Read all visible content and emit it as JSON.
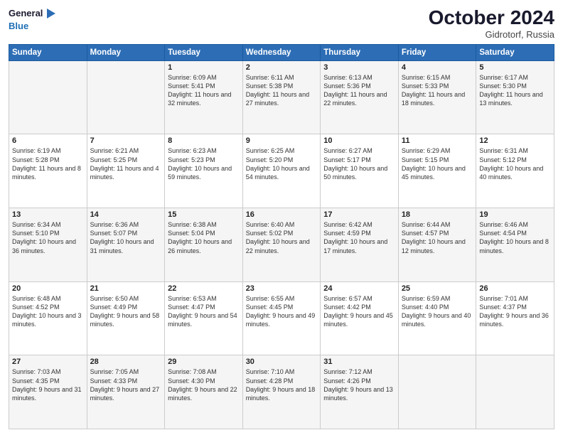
{
  "header": {
    "logo_line1": "General",
    "logo_line2": "Blue",
    "month": "October 2024",
    "location": "Gidrotorf, Russia"
  },
  "days_of_week": [
    "Sunday",
    "Monday",
    "Tuesday",
    "Wednesday",
    "Thursday",
    "Friday",
    "Saturday"
  ],
  "weeks": [
    [
      {
        "day": "",
        "sunrise": "",
        "sunset": "",
        "daylight": ""
      },
      {
        "day": "",
        "sunrise": "",
        "sunset": "",
        "daylight": ""
      },
      {
        "day": "1",
        "sunrise": "Sunrise: 6:09 AM",
        "sunset": "Sunset: 5:41 PM",
        "daylight": "Daylight: 11 hours and 32 minutes."
      },
      {
        "day": "2",
        "sunrise": "Sunrise: 6:11 AM",
        "sunset": "Sunset: 5:38 PM",
        "daylight": "Daylight: 11 hours and 27 minutes."
      },
      {
        "day": "3",
        "sunrise": "Sunrise: 6:13 AM",
        "sunset": "Sunset: 5:36 PM",
        "daylight": "Daylight: 11 hours and 22 minutes."
      },
      {
        "day": "4",
        "sunrise": "Sunrise: 6:15 AM",
        "sunset": "Sunset: 5:33 PM",
        "daylight": "Daylight: 11 hours and 18 minutes."
      },
      {
        "day": "5",
        "sunrise": "Sunrise: 6:17 AM",
        "sunset": "Sunset: 5:30 PM",
        "daylight": "Daylight: 11 hours and 13 minutes."
      }
    ],
    [
      {
        "day": "6",
        "sunrise": "Sunrise: 6:19 AM",
        "sunset": "Sunset: 5:28 PM",
        "daylight": "Daylight: 11 hours and 8 minutes."
      },
      {
        "day": "7",
        "sunrise": "Sunrise: 6:21 AM",
        "sunset": "Sunset: 5:25 PM",
        "daylight": "Daylight: 11 hours and 4 minutes."
      },
      {
        "day": "8",
        "sunrise": "Sunrise: 6:23 AM",
        "sunset": "Sunset: 5:23 PM",
        "daylight": "Daylight: 10 hours and 59 minutes."
      },
      {
        "day": "9",
        "sunrise": "Sunrise: 6:25 AM",
        "sunset": "Sunset: 5:20 PM",
        "daylight": "Daylight: 10 hours and 54 minutes."
      },
      {
        "day": "10",
        "sunrise": "Sunrise: 6:27 AM",
        "sunset": "Sunset: 5:17 PM",
        "daylight": "Daylight: 10 hours and 50 minutes."
      },
      {
        "day": "11",
        "sunrise": "Sunrise: 6:29 AM",
        "sunset": "Sunset: 5:15 PM",
        "daylight": "Daylight: 10 hours and 45 minutes."
      },
      {
        "day": "12",
        "sunrise": "Sunrise: 6:31 AM",
        "sunset": "Sunset: 5:12 PM",
        "daylight": "Daylight: 10 hours and 40 minutes."
      }
    ],
    [
      {
        "day": "13",
        "sunrise": "Sunrise: 6:34 AM",
        "sunset": "Sunset: 5:10 PM",
        "daylight": "Daylight: 10 hours and 36 minutes."
      },
      {
        "day": "14",
        "sunrise": "Sunrise: 6:36 AM",
        "sunset": "Sunset: 5:07 PM",
        "daylight": "Daylight: 10 hours and 31 minutes."
      },
      {
        "day": "15",
        "sunrise": "Sunrise: 6:38 AM",
        "sunset": "Sunset: 5:04 PM",
        "daylight": "Daylight: 10 hours and 26 minutes."
      },
      {
        "day": "16",
        "sunrise": "Sunrise: 6:40 AM",
        "sunset": "Sunset: 5:02 PM",
        "daylight": "Daylight: 10 hours and 22 minutes."
      },
      {
        "day": "17",
        "sunrise": "Sunrise: 6:42 AM",
        "sunset": "Sunset: 4:59 PM",
        "daylight": "Daylight: 10 hours and 17 minutes."
      },
      {
        "day": "18",
        "sunrise": "Sunrise: 6:44 AM",
        "sunset": "Sunset: 4:57 PM",
        "daylight": "Daylight: 10 hours and 12 minutes."
      },
      {
        "day": "19",
        "sunrise": "Sunrise: 6:46 AM",
        "sunset": "Sunset: 4:54 PM",
        "daylight": "Daylight: 10 hours and 8 minutes."
      }
    ],
    [
      {
        "day": "20",
        "sunrise": "Sunrise: 6:48 AM",
        "sunset": "Sunset: 4:52 PM",
        "daylight": "Daylight: 10 hours and 3 minutes."
      },
      {
        "day": "21",
        "sunrise": "Sunrise: 6:50 AM",
        "sunset": "Sunset: 4:49 PM",
        "daylight": "Daylight: 9 hours and 58 minutes."
      },
      {
        "day": "22",
        "sunrise": "Sunrise: 6:53 AM",
        "sunset": "Sunset: 4:47 PM",
        "daylight": "Daylight: 9 hours and 54 minutes."
      },
      {
        "day": "23",
        "sunrise": "Sunrise: 6:55 AM",
        "sunset": "Sunset: 4:45 PM",
        "daylight": "Daylight: 9 hours and 49 minutes."
      },
      {
        "day": "24",
        "sunrise": "Sunrise: 6:57 AM",
        "sunset": "Sunset: 4:42 PM",
        "daylight": "Daylight: 9 hours and 45 minutes."
      },
      {
        "day": "25",
        "sunrise": "Sunrise: 6:59 AM",
        "sunset": "Sunset: 4:40 PM",
        "daylight": "Daylight: 9 hours and 40 minutes."
      },
      {
        "day": "26",
        "sunrise": "Sunrise: 7:01 AM",
        "sunset": "Sunset: 4:37 PM",
        "daylight": "Daylight: 9 hours and 36 minutes."
      }
    ],
    [
      {
        "day": "27",
        "sunrise": "Sunrise: 7:03 AM",
        "sunset": "Sunset: 4:35 PM",
        "daylight": "Daylight: 9 hours and 31 minutes."
      },
      {
        "day": "28",
        "sunrise": "Sunrise: 7:05 AM",
        "sunset": "Sunset: 4:33 PM",
        "daylight": "Daylight: 9 hours and 27 minutes."
      },
      {
        "day": "29",
        "sunrise": "Sunrise: 7:08 AM",
        "sunset": "Sunset: 4:30 PM",
        "daylight": "Daylight: 9 hours and 22 minutes."
      },
      {
        "day": "30",
        "sunrise": "Sunrise: 7:10 AM",
        "sunset": "Sunset: 4:28 PM",
        "daylight": "Daylight: 9 hours and 18 minutes."
      },
      {
        "day": "31",
        "sunrise": "Sunrise: 7:12 AM",
        "sunset": "Sunset: 4:26 PM",
        "daylight": "Daylight: 9 hours and 13 minutes."
      },
      {
        "day": "",
        "sunrise": "",
        "sunset": "",
        "daylight": ""
      },
      {
        "day": "",
        "sunrise": "",
        "sunset": "",
        "daylight": ""
      }
    ]
  ]
}
